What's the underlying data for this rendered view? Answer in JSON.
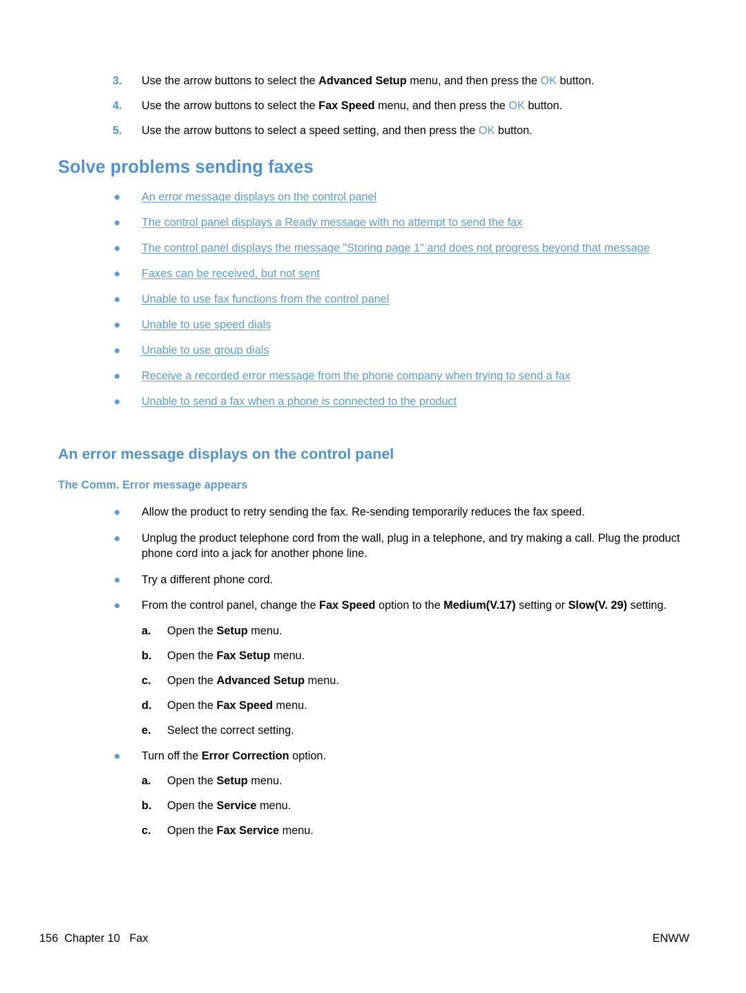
{
  "document": {
    "steps": [
      {
        "number": "3.",
        "pre": "Use the arrow buttons to select the ",
        "bold": "Advanced Setup",
        "mid": " menu, and then press the ",
        "ok": "OK",
        "post": " button."
      },
      {
        "number": "4.",
        "pre": "Use the arrow buttons to select the ",
        "bold": "Fax Speed",
        "mid": " menu, and then press the ",
        "ok": "OK",
        "post": " button."
      },
      {
        "number": "5.",
        "pre": "Use the arrow buttons to select a speed setting, and then press the ",
        "bold": "",
        "mid": "",
        "ok": "OK",
        "post": " button."
      }
    ],
    "section_heading": "Solve problems sending faxes",
    "links": [
      "An error message displays on the control panel",
      "The control panel displays a Ready message with no attempt to send the fax",
      "The control panel displays the message \"Storing page 1\" and does not progress beyond that message",
      "Faxes can be received, but not sent",
      "Unable to use fax functions from the control panel",
      "Unable to use speed dials",
      "Unable to use group dials",
      "Receive a recorded error message from the phone company when trying to send a fax",
      "Unable to send a fax when a phone is connected to the product"
    ],
    "subsection_heading": "An error message displays on the control panel",
    "subsubsection_heading": "The Comm. Error message appears",
    "bullets": [
      {
        "text_pre": "Allow the product to retry sending the fax. Re-sending temporarily reduces the fax speed.",
        "bold1": "",
        "text_mid": "",
        "bold2": "",
        "text_mid2": "",
        "bold3": "",
        "text_post": "",
        "sub": []
      },
      {
        "text_pre": "Unplug the product telephone cord from the wall, plug in a telephone, and try making a call. Plug the product phone cord into a jack for another phone line.",
        "bold1": "",
        "text_mid": "",
        "bold2": "",
        "text_mid2": "",
        "bold3": "",
        "text_post": "",
        "sub": []
      },
      {
        "text_pre": "Try a different phone cord.",
        "bold1": "",
        "text_mid": "",
        "bold2": "",
        "text_mid2": "",
        "bold3": "",
        "text_post": "",
        "sub": []
      },
      {
        "text_pre": "From the control panel, change the ",
        "bold1": "Fax Speed",
        "text_mid": " option to the ",
        "bold2": "Medium(V.17)",
        "text_mid2": " setting or ",
        "bold3": "Slow(V. 29)",
        "text_post": " setting.",
        "sub": [
          {
            "letter": "a.",
            "pre": "Open the ",
            "bold": "Setup",
            "post": " menu."
          },
          {
            "letter": "b.",
            "pre": "Open the ",
            "bold": "Fax Setup",
            "post": " menu."
          },
          {
            "letter": "c.",
            "pre": "Open the ",
            "bold": "Advanced Setup",
            "post": " menu."
          },
          {
            "letter": "d.",
            "pre": "Open the ",
            "bold": "Fax Speed",
            "post": " menu."
          },
          {
            "letter": "e.",
            "pre": "Select the correct setting.",
            "bold": "",
            "post": ""
          }
        ]
      },
      {
        "text_pre": "Turn off the ",
        "bold1": "Error Correction",
        "text_mid": " option.",
        "bold2": "",
        "text_mid2": "",
        "bold3": "",
        "text_post": "",
        "sub": [
          {
            "letter": "a.",
            "pre": "Open the ",
            "bold": "Setup",
            "post": " menu."
          },
          {
            "letter": "b.",
            "pre": "Open the ",
            "bold": "Service",
            "post": " menu."
          },
          {
            "letter": "c.",
            "pre": "Open the ",
            "bold": "Fax Service",
            "post": " menu."
          }
        ]
      }
    ],
    "footer": {
      "left": "156  Chapter 10   Fax",
      "right": "ENWW"
    },
    "colors": {
      "heading_blue": "#4d93d4",
      "link_blue": "#5b9bd5",
      "bullet_blue": "#5b9bd5",
      "ok_blue": "#5b9bd5",
      "body_black": "#000000"
    }
  }
}
